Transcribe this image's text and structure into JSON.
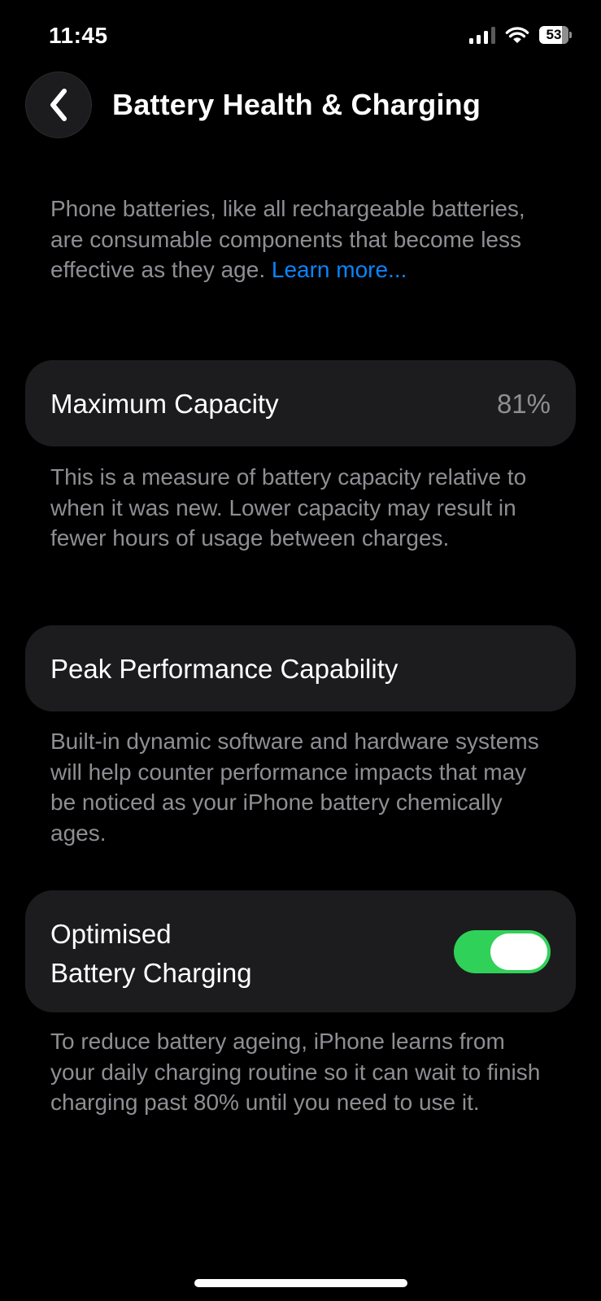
{
  "status_bar": {
    "time": "11:45",
    "battery_level": "53",
    "signal_bars_active": 3,
    "signal_bars_total": 4,
    "icons": [
      "cellular-signal-icon",
      "wifi-icon",
      "battery-icon"
    ]
  },
  "nav": {
    "back_icon": "chevron-left-icon",
    "title": "Battery Health & Charging"
  },
  "intro": {
    "text": "Phone batteries, like all rechargeable batteries, are consumable components that become less effective as they age.",
    "link": "Learn more..."
  },
  "capacity": {
    "label": "Maximum Capacity",
    "value": "81%",
    "caption": "This is a measure of battery capacity relative to when it was new. Lower capacity may result in fewer hours of usage between charges."
  },
  "peak": {
    "label": "Peak Performance Capability",
    "caption": "Built-in dynamic software and hardware systems will help counter performance impacts that may be noticed as your iPhone battery chemically ages."
  },
  "charging": {
    "label_line1": "Optimised",
    "label_line2": "Battery Charging",
    "toggle_on": true,
    "caption": "To reduce battery ageing, iPhone learns from your daily charging routine so it can wait to finish charging past 80% until you need to use it."
  },
  "colors": {
    "background": "#000000",
    "cell": "#1c1c1e",
    "secondary_text": "#8e8e93",
    "link": "#0a84ff",
    "toggle_on": "#30d158"
  }
}
